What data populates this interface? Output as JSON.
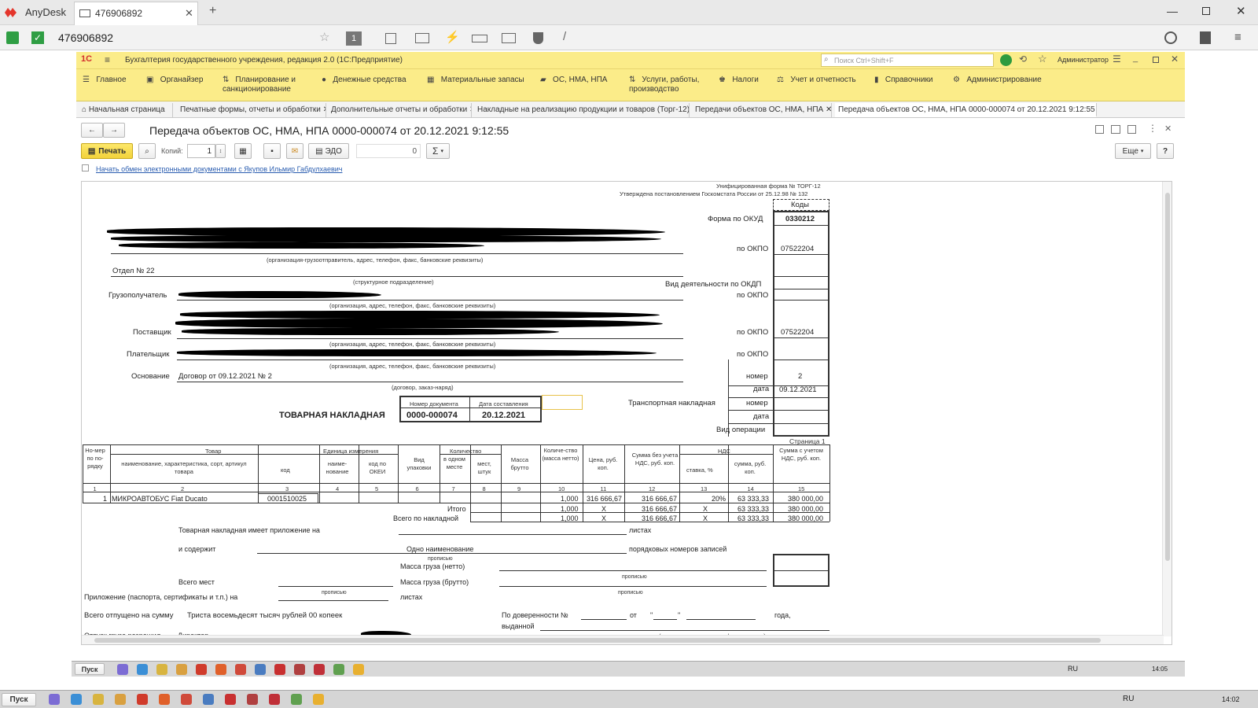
{
  "anydesk": {
    "brand": "AnyDesk",
    "tab_title": "476906892",
    "address_value": "476906892"
  },
  "app": {
    "title": "Бухгалтерия государственного учреждения, редакция 2.0 (1С:Предприятие)",
    "search_placeholder": "Поиск Ctrl+Shift+F",
    "user": "Администратор",
    "menu": [
      "Главное",
      "Органайзер",
      "Планирование и санкционирование",
      "Денежные средства",
      "Материальные запасы",
      "ОС, НМА, НПА",
      "Услуги, работы, производство",
      "Налоги",
      "Учет и отчетность",
      "Справочники",
      "Администрирование"
    ],
    "tabs": [
      "Начальная страница",
      "Печатные формы, отчеты и обработки",
      "Дополнительные отчеты и обработки",
      "Накладные на реализацию продукции и товаров (Торг-12)",
      "Передачи объектов ОС, НМА, НПА",
      "Передача объектов ОС, НМА, НПА 0000-000074 от 20.12.2021 9:12:55"
    ],
    "doc_title": "Передача объектов ОС, НМА, НПА 0000-000074 от 20.12.2021 9:12:55",
    "toolbar": {
      "print_label": "Печать",
      "copies_label": "Копий:",
      "copies_value": "1",
      "edo_label": "ЭДО",
      "sum_value": "0",
      "sum_symbol": "Σ",
      "more_label": "Еще",
      "help_label": "?"
    },
    "edo_link": "Начать обмен электронными документами с Якупов Ильмир Габдулхаевич"
  },
  "form": {
    "unified": "Унифицированная форма № ТОРГ-12",
    "approved": "Утверждена постановлением Госкомстата России от 25.12.98 № 132",
    "codes_header": "Коды",
    "okud_label": "Форма по ОКУД",
    "okud_value": "0330212",
    "okpo_label": "по ОКПО",
    "okpo1": "07522204",
    "shipper_caption": "(организация-грузоотправитель, адрес, телефон, факс, банковские реквизиты)",
    "dept": "Отдел № 22",
    "dept_caption": "(структурное подразделение)",
    "okdp_label": "Вид деятельности по ОКДП",
    "consignee_label": "Грузополучатель",
    "org_caption": "(организация, адрес, телефон, факс, банковские реквизиты)",
    "supplier_label": "Поставщик",
    "okpo_supplier": "07522204",
    "payer_label": "Плательщик",
    "basis_label": "Основание",
    "basis_value": "Договор от 09.12.2021 № 2",
    "basis_caption": "(договор, заказ-наряд)",
    "nomer_label": "номер",
    "nomer_value": "2",
    "data_label": "дата",
    "data_value": "09.12.2021",
    "transport_label": "Транспортная накладная",
    "vid_oper_label": "Вид операции",
    "doc_num_header": "Номер документа",
    "doc_date_header": "Дата составления",
    "doc_heading": "ТОВАРНАЯ НАКЛАДНАЯ",
    "doc_number": "0000-000074",
    "doc_date": "20.12.2021",
    "page_label": "Страница 1"
  },
  "table": {
    "h_num": "Но-мер по по-рядку",
    "h_goods": "Товар",
    "h_goods_name": "наименование, характеристика, сорт, артикул товара",
    "h_code": "код",
    "h_unit": "Единица измерения",
    "h_unit_name": "наиме-нование",
    "h_okei": "код по ОКЕИ",
    "h_pack": "Вид упаковки",
    "h_qty": "Количество",
    "h_qty_one": "в одном месте",
    "h_places": "мест, штук",
    "h_gross": "Масса брутто",
    "h_net": "Количе-ство (масса нетто)",
    "h_price": "Цена, руб. коп.",
    "h_sum_no_vat": "Сумма без учета НДС, руб. коп.",
    "h_vat": "НДС",
    "h_vat_rate": "ставка, %",
    "h_vat_sum": "сумма, руб. коп.",
    "h_total": "Сумма с учетом НДС, руб. коп.",
    "col_numbers": [
      "1",
      "2",
      "3",
      "4",
      "5",
      "6",
      "7",
      "8",
      "9",
      "10",
      "11",
      "12",
      "13",
      "14",
      "15"
    ],
    "row": {
      "n": "1",
      "name": "МИКРОАВТОБУС Fiat Ducato",
      "code": "0001510025",
      "net": "1,000",
      "price": "316 666,67",
      "sum": "316 666,67",
      "rate": "20%",
      "vat": "63 333,33",
      "total": "380 000,00"
    },
    "itogo_label": "Итого",
    "itogo": {
      "net": "1,000",
      "price": "X",
      "sum": "316 666,67",
      "rate": "X",
      "vat": "63 333,33",
      "total": "380 000,00"
    },
    "vsego_label": "Всего по накладной",
    "vsego": {
      "net": "1,000",
      "price": "X",
      "sum": "316 666,67",
      "rate": "X",
      "vat": "63 333,33",
      "total": "380 000,00"
    }
  },
  "footer": {
    "appendix": "Товарная накладная имеет приложение на",
    "sheets": "листах",
    "contains": "и содержит",
    "one_name": "Одно наименование",
    "records": "порядковых номеров записей",
    "propis": "прописью",
    "mass_net": "Масса груза (нетто)",
    "mass_gross": "Масса груза (брутто)",
    "places_total": "Всего мест",
    "attach": "Приложение (паспорта, сертификаты и т.п.) на",
    "released": "Всего отпущено на сумму",
    "released_value": "Триста восемьдесят тысяч рублей 00 копеек",
    "permitted": "Отпуск груза разрешил",
    "director": "Директор",
    "proxy": "По доверенности №",
    "from": "от",
    "quote": "\"",
    "year": "года,",
    "issued": "выданной",
    "issued_caption": "кем, кому (организация, должность, фамилия, и. о.)"
  },
  "taskbar": {
    "start": "Пуск",
    "lang": "RU",
    "clock_inner": "14:05",
    "clock_outer": "14:02"
  }
}
